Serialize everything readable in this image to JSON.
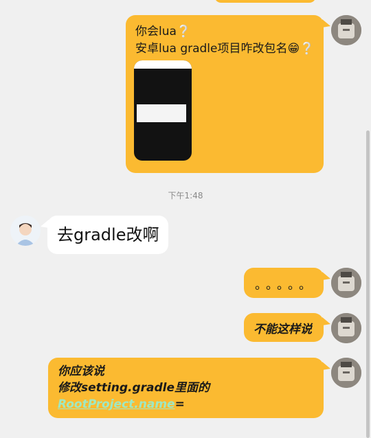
{
  "messages": [
    {
      "id": "m1",
      "from": "me",
      "lines": [
        "你会lua",
        "安卓lua gradle项目咋改包名"
      ],
      "question_mark": "❔",
      "emoji": "😁",
      "has_image": true
    },
    {
      "id": "time",
      "text": "下午1:48"
    },
    {
      "id": "m2",
      "from": "other",
      "text": "去gradle改啊"
    },
    {
      "id": "m3",
      "from": "me",
      "text": "。。。。。"
    },
    {
      "id": "m4",
      "from": "me",
      "text": "不能这样说"
    },
    {
      "id": "m5",
      "from": "me",
      "lines": [
        "你应该说",
        "修改setting.gradle里面的"
      ],
      "link_text": "RootProject.name",
      "suffix": "="
    }
  ],
  "colors": {
    "my_bubble": "#fbba31",
    "other_bubble": "#ffffff",
    "background": "#f0f0f0",
    "link": "#9fe8c2"
  }
}
